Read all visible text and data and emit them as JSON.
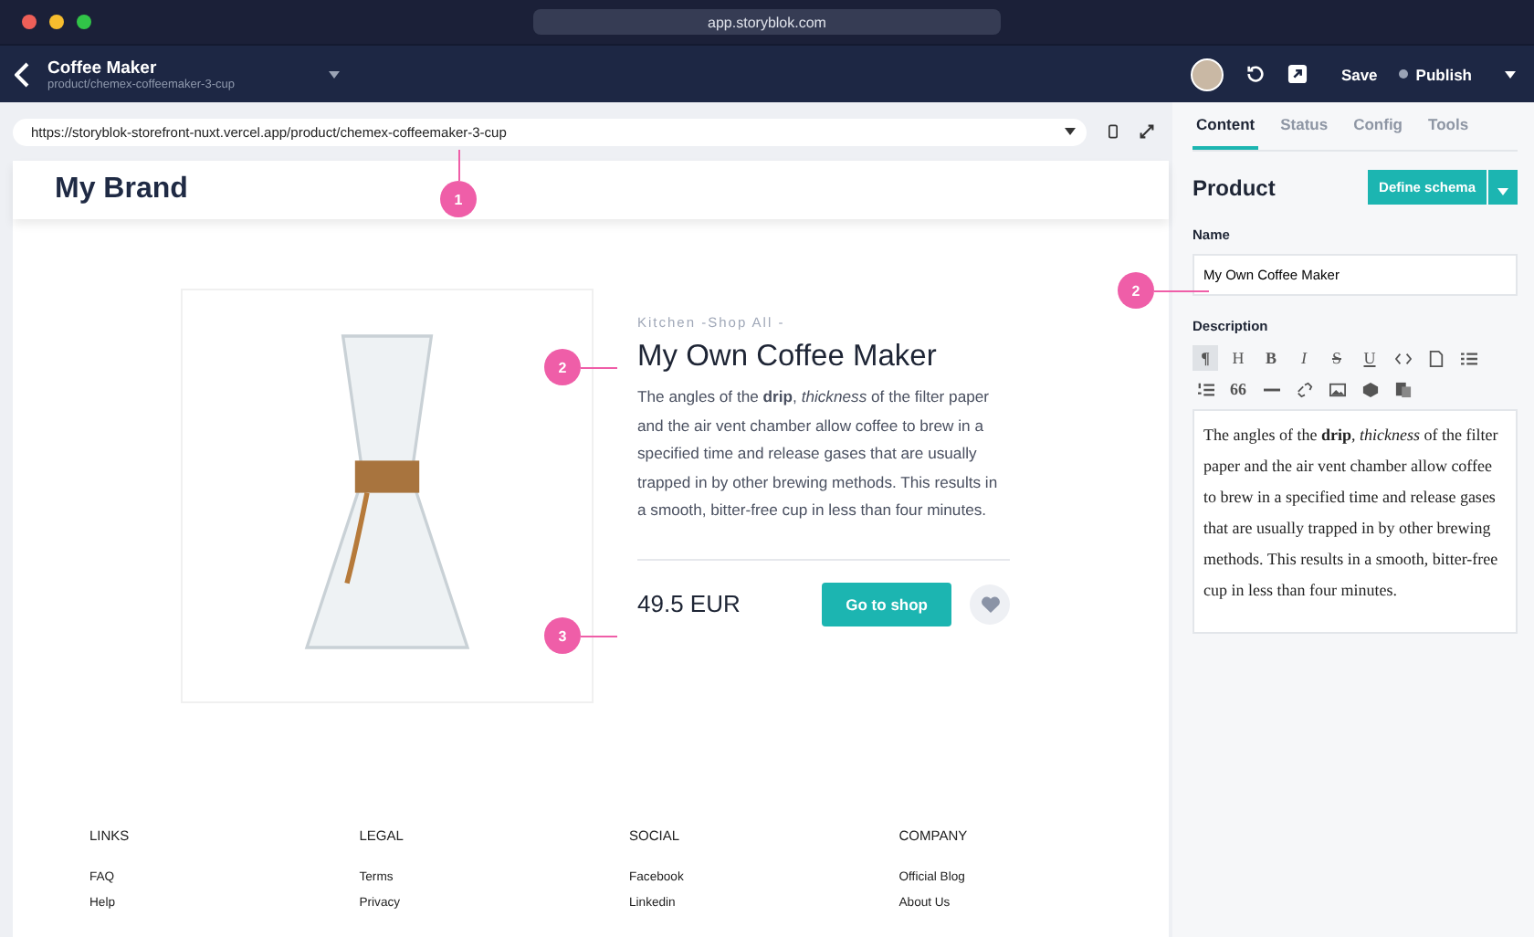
{
  "window": {
    "address": "app.storyblok.com"
  },
  "header": {
    "title": "Coffee Maker",
    "slug": "product/chemex-coffeemaker-3-cup",
    "save": "Save",
    "publish": "Publish"
  },
  "preview": {
    "url": "https://storyblok-storefront-nuxt.vercel.app/product/chemex-coffeemaker-3-cup",
    "brand": "My Brand",
    "product": {
      "breadcrumb": "Kitchen -Shop All -",
      "title": "My Own Coffee Maker",
      "description": "The angles of the **drip**, *thickness* of the filter paper and the air vent chamber allow coffee to brew in a specified time and release gases that are usually trapped in by other brewing methods. This results in a smooth, bitter-free cup in less than four minutes.",
      "price": "49.5 EUR",
      "button": "Go to shop"
    },
    "footer": [
      {
        "heading": "LINKS",
        "links": [
          "FAQ",
          "Help"
        ]
      },
      {
        "heading": "LEGAL",
        "links": [
          "Terms",
          "Privacy"
        ]
      },
      {
        "heading": "SOCIAL",
        "links": [
          "Facebook",
          "Linkedin"
        ]
      },
      {
        "heading": "COMPANY",
        "links": [
          "Official Blog",
          "About Us"
        ]
      }
    ]
  },
  "annotations": [
    "1",
    "2",
    "3",
    "2"
  ],
  "panel": {
    "tabs": [
      {
        "label": "Content",
        "selected": true
      },
      {
        "label": "Status",
        "selected": false
      },
      {
        "label": "Config",
        "selected": false
      },
      {
        "label": "Tools",
        "selected": false
      }
    ],
    "title": "Product",
    "schema_button": "Define schema",
    "name_label": "Name",
    "name_value": "My Own Coffee Maker",
    "description_label": "Description",
    "toolbar": [
      {
        "kind": "text",
        "label": "¶",
        "selected": true
      },
      {
        "kind": "text",
        "label": "H",
        "selected": false
      },
      {
        "kind": "text",
        "label": "B",
        "selected": false
      },
      {
        "kind": "text",
        "label": "I",
        "selected": false
      },
      {
        "kind": "text",
        "label": "S",
        "selected": false
      },
      {
        "kind": "text",
        "label": "U",
        "selected": false
      },
      {
        "kind": "icon",
        "selected": false
      },
      {
        "kind": "icon",
        "selected": false
      },
      {
        "kind": "icon",
        "selected": false
      },
      {
        "kind": "icon",
        "selected": false
      },
      {
        "kind": "text",
        "label": "66",
        "selected": false
      },
      {
        "kind": "icon",
        "selected": false
      },
      {
        "kind": "icon",
        "selected": false
      },
      {
        "kind": "icon",
        "selected": false
      },
      {
        "kind": "icon",
        "selected": false
      },
      {
        "kind": "icon",
        "selected": false
      }
    ],
    "description": "The angles of the **drip**, *thickness* of the filter paper and the air vent chamber allow coffee to brew in a specified time and release gases that are usually trapped in by other brewing methods. This results in a smooth, bitter-free cup in less than four minutes."
  }
}
